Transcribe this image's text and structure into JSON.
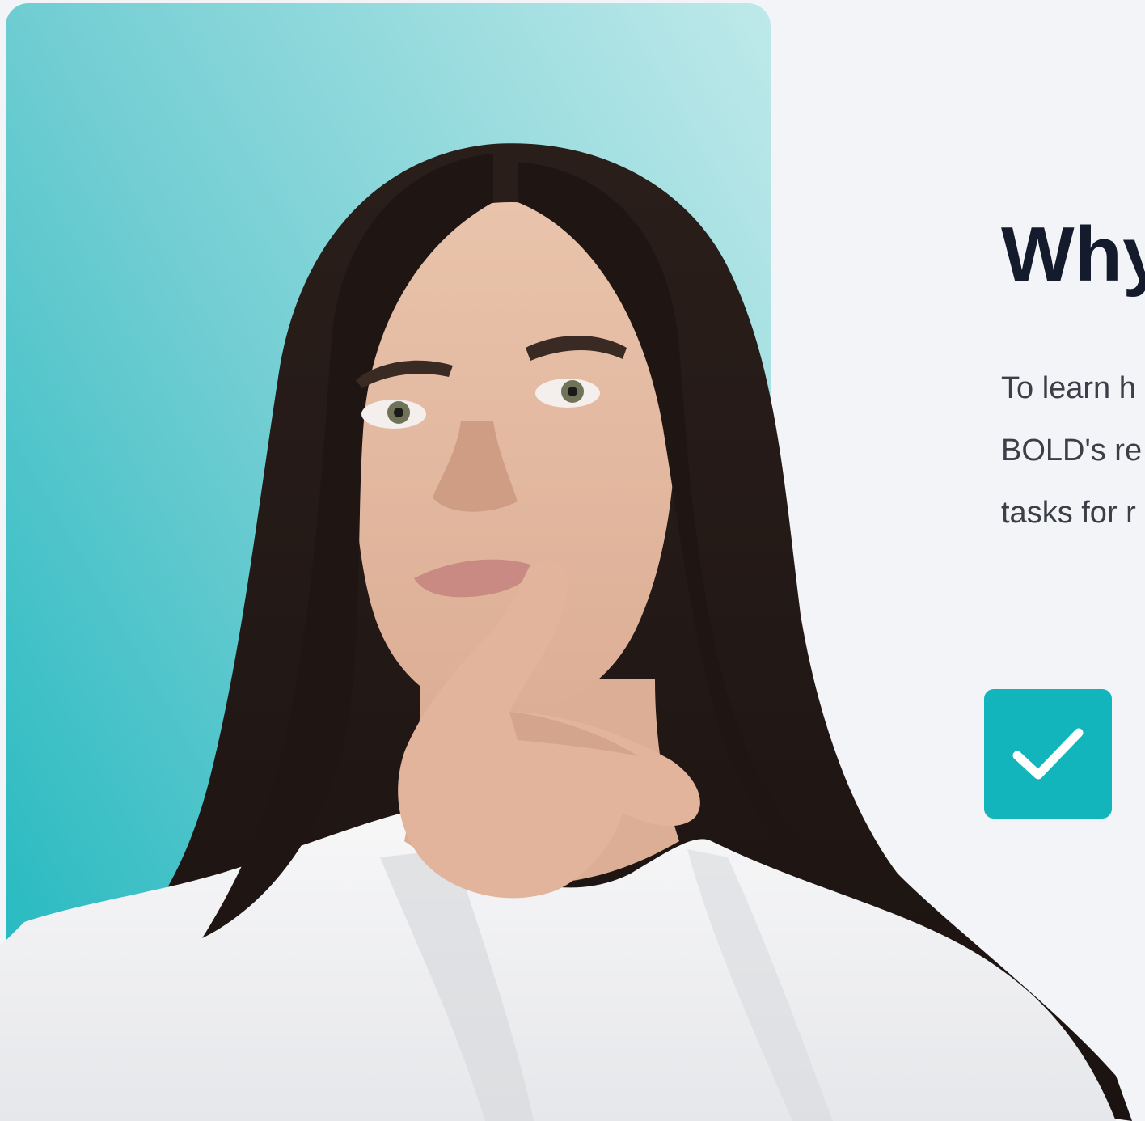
{
  "section": {
    "headline": "Why",
    "body_lines": [
      "To learn h",
      "BOLD's re",
      "tasks for r"
    ]
  },
  "icons": {
    "check_badge": "checkmark-icon"
  },
  "colors": {
    "accent": "#11b5bb",
    "card_gradient_start": "#1fb8bf",
    "card_gradient_end": "#bfe9ea",
    "page_background": "#f3f4f7",
    "headline_text": "#141b2d",
    "body_text": "#3c3f47"
  }
}
